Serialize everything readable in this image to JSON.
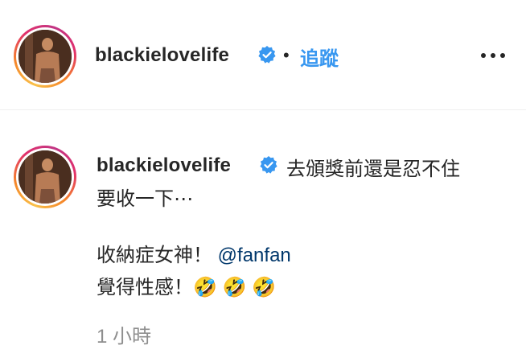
{
  "post_header": {
    "username": "blackielovelife",
    "separator": "•",
    "follow_label": "追蹤",
    "verified_icon": "verified-badge-icon",
    "more_icon": "more-options-icon"
  },
  "caption": {
    "username": "blackielovelife",
    "verified_icon": "verified-badge-icon",
    "line1": "去頒獎前還是忍不住",
    "line2": "要收一下⋯",
    "line3_prefix": "收納症女神！ ",
    "mention": "@fanfan",
    "line4_text": "覺得性感！",
    "emoji": [
      "🤣",
      "🤣",
      "🤣"
    ],
    "timestamp": "1 小時"
  },
  "colors": {
    "accent": "#3897f0",
    "verified": "#3897f0",
    "mention": "#00376b",
    "muted": "#8e8e8e",
    "text": "#262626"
  }
}
